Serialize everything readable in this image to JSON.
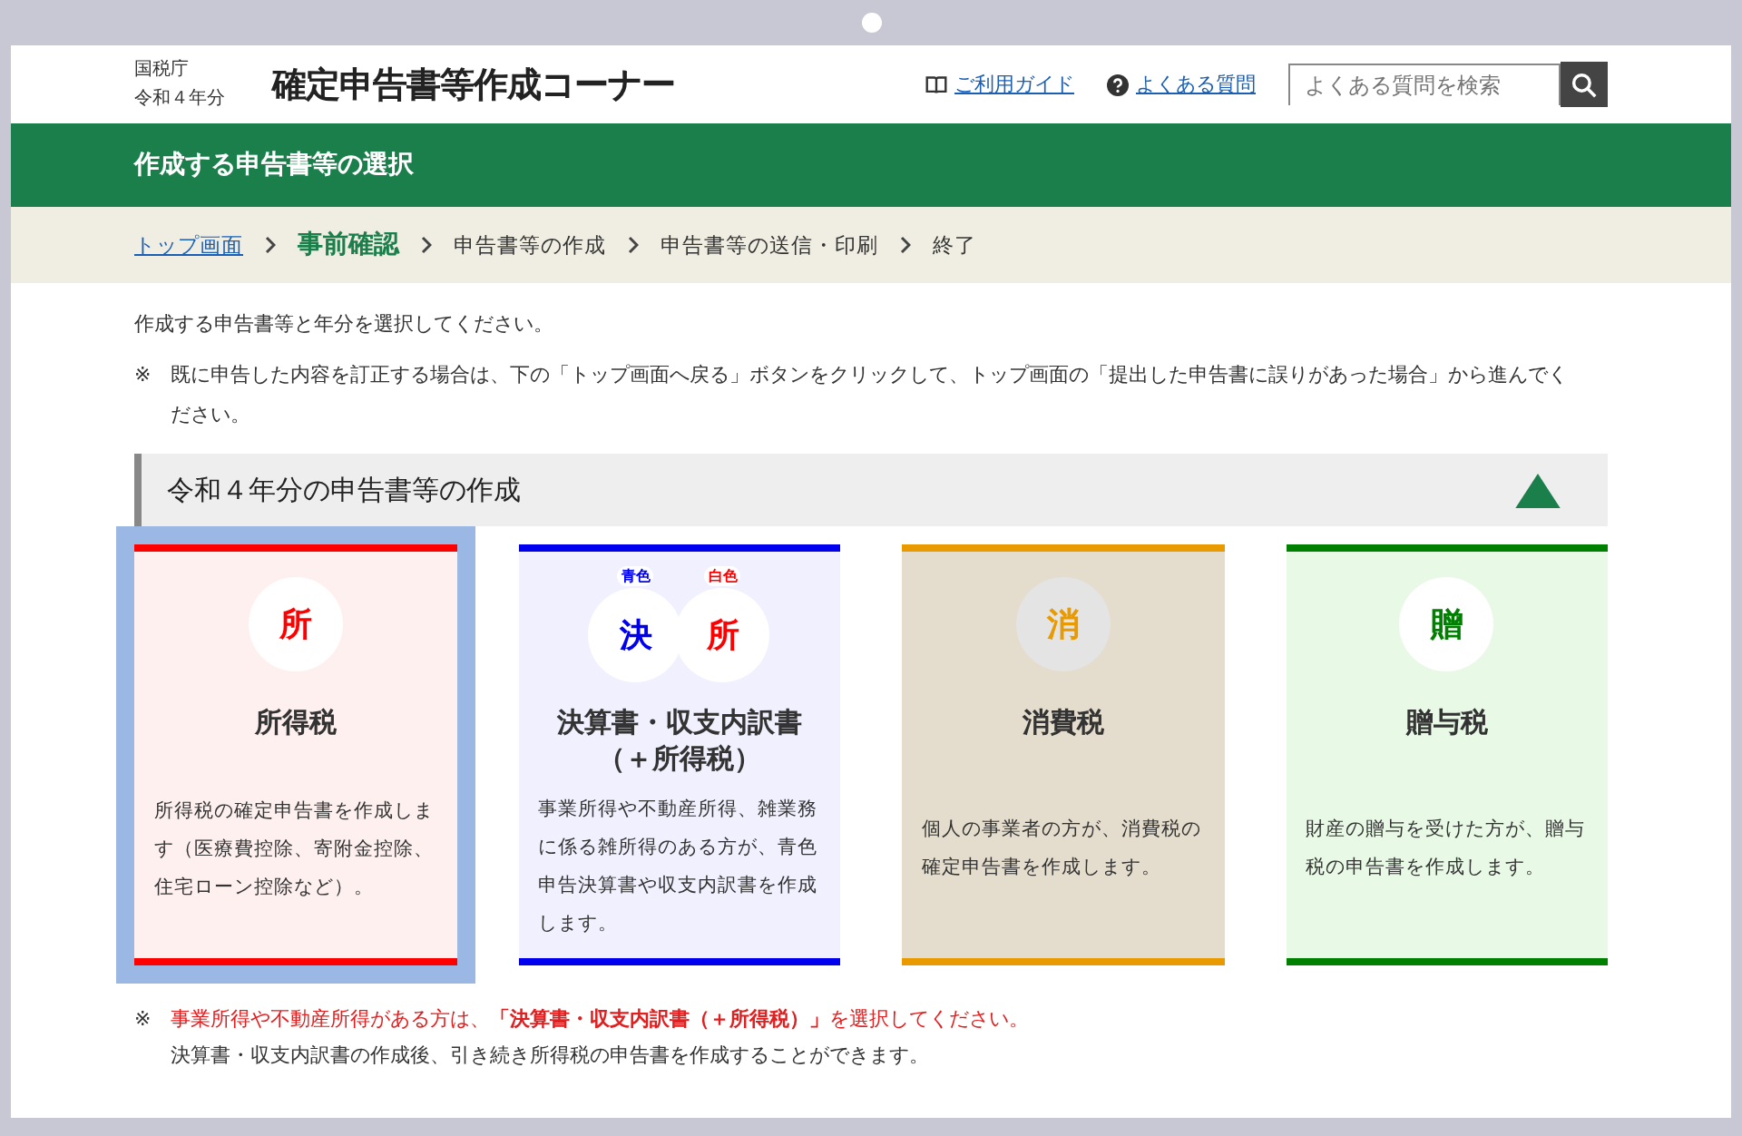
{
  "header": {
    "agency": "国税庁",
    "year": "令和４年分",
    "title": "確定申告書等作成コーナー",
    "links": [
      {
        "kind": "guide",
        "label": "ご利用ガイド"
      },
      {
        "kind": "faq",
        "label": "よくある質問"
      }
    ],
    "search": {
      "placeholder": "よくある質問を検索"
    }
  },
  "page_title": "作成する申告書等の選択",
  "breadcrumb": [
    {
      "label": "トップ画面",
      "kind": "link",
      "selected": false
    },
    {
      "label": "事前確認",
      "kind": "step",
      "selected": true
    },
    {
      "label": "申告書等の作成",
      "kind": "step",
      "selected": false
    },
    {
      "label": "申告書等の送信・印刷",
      "kind": "step",
      "selected": false
    },
    {
      "label": "終了",
      "kind": "step",
      "selected": false
    }
  ],
  "intro": "作成する申告書等と年分を選択してください。",
  "note": {
    "mark": "※",
    "text": "既に申告した内容を訂正する場合は、下の「トップ画面へ戻る」ボタンをクリックして、トップ画面の「提出した申告書に誤りがあった場合」から進んでください。"
  },
  "section": {
    "title": "令和４年分の申告書等の作成",
    "expanded": true
  },
  "cards": [
    {
      "title": "所得税",
      "description": "所得税の確定申告書を作成します（医療費控除、寄附金控除、住宅ローン控除など）。",
      "color": "#ff0000",
      "selected": true,
      "icons": [
        {
          "char": "所",
          "color": "#ff0000"
        }
      ]
    },
    {
      "title": "決算書・収支内訳書（＋所得税）",
      "description": "事業所得や不動産所得、雑業務に係る雑所得のある方が、青色申告決算書や収支内訳書を作成します。",
      "color": "#0000ee",
      "selected": false,
      "icons": [
        {
          "char": "決",
          "color": "#0000ee",
          "label": "青色"
        },
        {
          "char": "所",
          "color": "#ff0000",
          "label": "白色"
        }
      ]
    },
    {
      "title": "消費税",
      "description": "個人の事業者の方が、消費税の確定申告書を作成します。",
      "color": "#e89a00",
      "selected": false,
      "icons": [
        {
          "char": "消",
          "color": "#e89a00"
        }
      ]
    },
    {
      "title": "贈与税",
      "description": "財産の贈与を受けた方が、贈与税の申告書を作成します。",
      "color": "#008000",
      "selected": false,
      "icons": [
        {
          "char": "贈",
          "color": "#008000"
        }
      ]
    }
  ],
  "footnote": {
    "mark": "※",
    "warning": "事業所得や不動産所得がある方は、**「決算書・収支内訳書（＋所得税）」**を選択してください。",
    "text": "決算書・収支内訳書の作成後、引き続き所得税の申告書を作成することができます。"
  }
}
